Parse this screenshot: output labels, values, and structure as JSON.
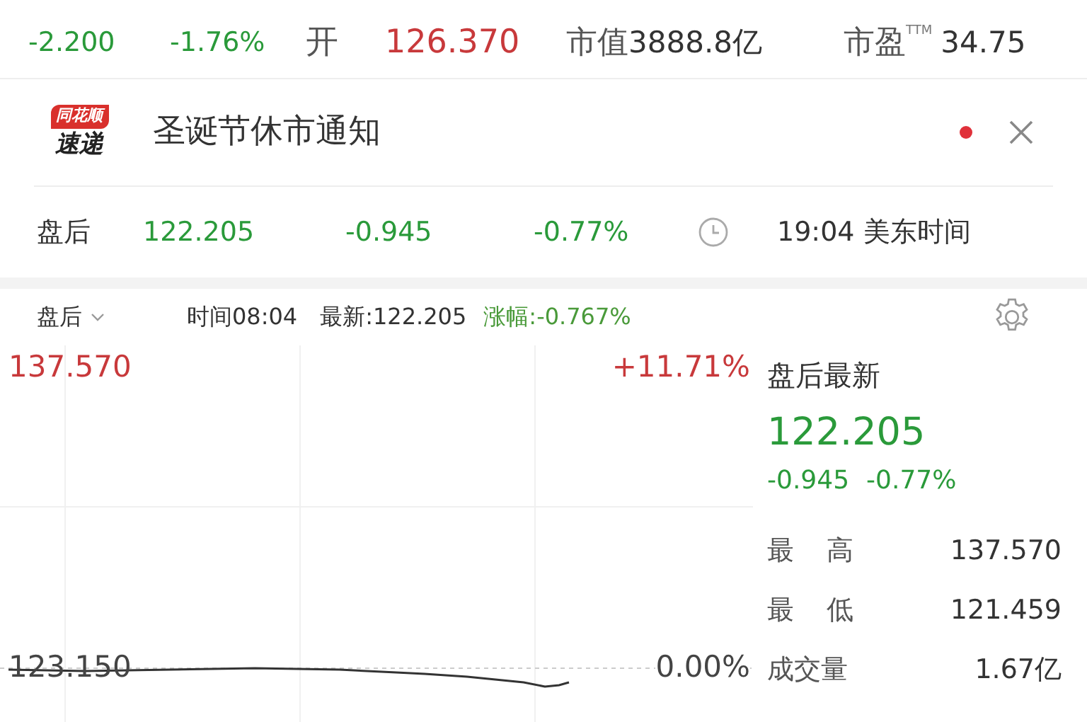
{
  "quote": {
    "change": "-2.200",
    "change_pct": "-1.76%",
    "open_label": "开",
    "open": "126.370",
    "mcap_label": "市值",
    "mcap": "3888.8亿",
    "pe_label": "市盈",
    "pe_sup": "TTM",
    "pe": "34.75"
  },
  "notice": {
    "logo_top": "同花顺",
    "logo_bottom": "速递",
    "title": "圣诞节休市通知",
    "unread": true
  },
  "after_hours": {
    "label": "盘后",
    "price": "122.205",
    "change": "-0.945",
    "change_pct": "-0.77%",
    "time": "19:04 美东时间"
  },
  "chart_header": {
    "mode": "盘后",
    "time": "时间08:04",
    "latest": "最新:122.205",
    "change": "涨幅:-0.767%"
  },
  "chart": {
    "high_price": "137.570",
    "high_pct": "+11.71%",
    "base_price": "123.150",
    "base_pct": "0.00%"
  },
  "panel": {
    "title": "盘后最新",
    "price": "122.205",
    "change": "-0.945",
    "change_pct": "-0.77%",
    "stats": [
      {
        "label": "最 高",
        "value": "137.570"
      },
      {
        "label": "最 低",
        "value": "121.459"
      },
      {
        "label": "成交量",
        "value": "1.67亿"
      }
    ]
  }
}
